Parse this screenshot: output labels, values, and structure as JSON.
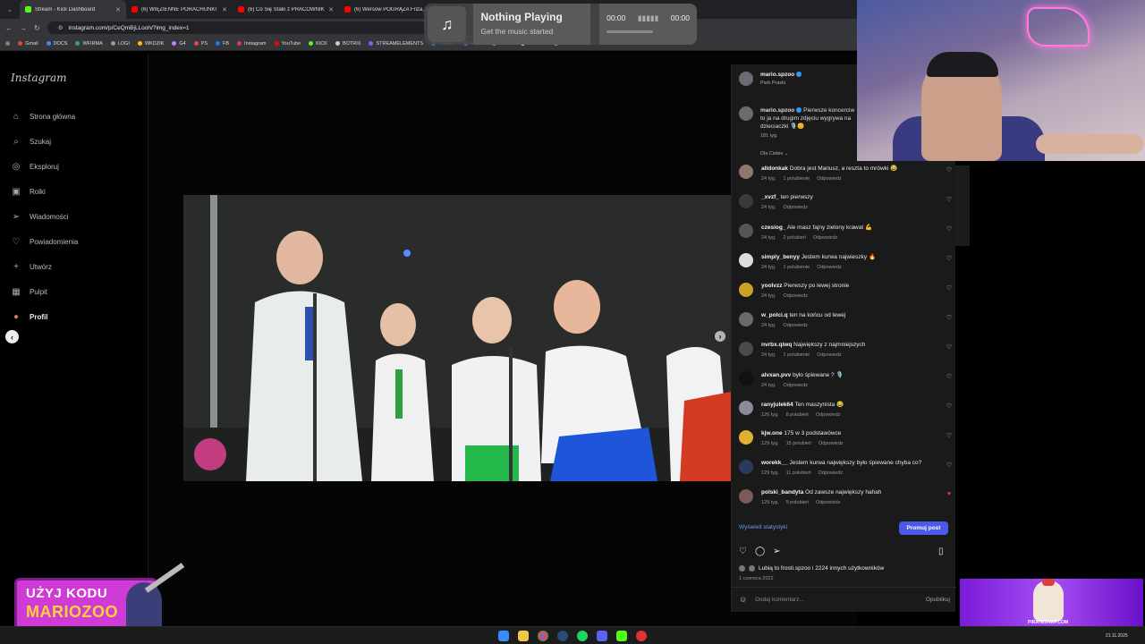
{
  "tabs": [
    {
      "label": "Stream - Kick Dashboard",
      "color": "#53fc18"
    },
    {
      "label": "(6) WIĘZIENNE PORACHUNKI |",
      "color": "#ff0000"
    },
    {
      "label": "(6) Co Się Stało z PRACOWNIK",
      "color": "#ff0000"
    },
    {
      "label": "(6) Wersow POGRĄŻA Friza, a",
      "color": "#ff0000"
    }
  ],
  "url": "instagram.com/p/CeQmBjLLooh/?img_index=1",
  "bookmarks": [
    "Gmail",
    "DOCS",
    "WFIRMA",
    "LOGI",
    "WKDZIK",
    "G4",
    "PS",
    "FB",
    "Instagram",
    "YouTube",
    "KICK",
    "BOTRIX",
    "STREAMELEMENTS",
    "TWEET",
    "HYPE",
    "NEST",
    "TIKTOK",
    "NATIVNOSE"
  ],
  "now_playing": {
    "title": "Nothing Playing",
    "subtitle": "Get the music started",
    "time_start": "00:00",
    "time_end": "00:00"
  },
  "sidebar": {
    "logo": "Instagram",
    "items": [
      {
        "label": "Strona główna",
        "icon": "home-icon",
        "glyph": "⌂"
      },
      {
        "label": "Szukaj",
        "icon": "search-icon",
        "glyph": "⌕"
      },
      {
        "label": "Eksploruj",
        "icon": "compass-icon",
        "glyph": "◎"
      },
      {
        "label": "Rolki",
        "icon": "reels-icon",
        "glyph": "▣"
      },
      {
        "label": "Wiadomości",
        "icon": "send-icon",
        "glyph": "➢"
      },
      {
        "label": "Powiadomienia",
        "icon": "heart-icon",
        "glyph": "♡"
      },
      {
        "label": "Utwórz",
        "icon": "plus-icon",
        "glyph": "+"
      },
      {
        "label": "Pulpit",
        "icon": "dashboard-icon",
        "glyph": "▦"
      },
      {
        "label": "Profil",
        "icon": "avatar-icon",
        "glyph": "●"
      }
    ]
  },
  "post": {
    "username": "mario.spzoo",
    "location": "Park Praski",
    "caption": "Pierwsze koncerciw to ja na drugim zdjęciu wygrywa na dzieciaczki 🎙️😊",
    "caption_time": "181 tyg.",
    "filter_label": "Dla Ciebie",
    "comments": [
      {
        "user": "alldonkak",
        "text": "Dobra jest Mariusz, a reszta to mrówki 😂",
        "time": "24 tyg.",
        "likes": "1 polubienie",
        "reply": "Odpowiedz",
        "avatar": "#8a7a70",
        "liked": false
      },
      {
        "user": "_xvzf_",
        "text": "ten pierwszy",
        "time": "24 tyg.",
        "likes": "",
        "reply": "Odpowiedz",
        "avatar": "#3a3a3a",
        "liked": false
      },
      {
        "user": "czesiog_",
        "text": "Ale masz fajny zielony krawat 💪",
        "time": "24 tyg.",
        "likes": "2 polubień",
        "reply": "Odpowiedz",
        "avatar": "#555555",
        "liked": false
      },
      {
        "user": "simply_benyy",
        "text": "Jestem kurwa najwieszky 🔥",
        "time": "24 tyg.",
        "likes": "1 polubienie",
        "reply": "Odpowiedz",
        "avatar": "#dddddd",
        "liked": false
      },
      {
        "user": "yoolvzz",
        "text": "Pierwszy po lewej stronie",
        "time": "24 tyg.",
        "likes": "",
        "reply": "Odpowiedz",
        "avatar": "#c9a227",
        "liked": false
      },
      {
        "user": "w_polci.q",
        "text": "ten na końcu od lewej",
        "time": "24 tyg.",
        "likes": "",
        "reply": "Odpowiedz",
        "avatar": "#6a6a6a",
        "liked": false
      },
      {
        "user": "nvrbx.qiwq",
        "text": "Największy z najmniejszych",
        "time": "24 tyg.",
        "likes": "1 polubienie",
        "reply": "Odpowiedz",
        "avatar": "#4a4a4a",
        "liked": false
      },
      {
        "user": "alvxan.pvv",
        "text": "było śpiewane ? 🎙️",
        "time": "24 tyg.",
        "likes": "",
        "reply": "Odpowiedz",
        "avatar": "#111111",
        "liked": false
      },
      {
        "user": "ranyjulek64",
        "text": "Ten maszynista 😂",
        "time": "126 tyg.",
        "likes": "8 polubień",
        "reply": "Odpowiedz",
        "avatar": "#8a8a9a",
        "liked": false
      },
      {
        "user": "kjw.one",
        "text": "175 w 3 podstawówce",
        "time": "129 tyg.",
        "likes": "15 polubień",
        "reply": "Odpowiedz",
        "avatar": "#e0b030",
        "liked": false
      },
      {
        "user": "worekk__",
        "text": "Jestem kurwa największy było śpiewane chyba co?",
        "time": "129 tyg.",
        "likes": "11 polubień",
        "reply": "Odpowiedz",
        "avatar": "#2a3a5a",
        "liked": false
      },
      {
        "user": "polski_bandyta",
        "text": "Od zawsze największy hahah",
        "time": "129 tyg.",
        "likes": "9 polubień",
        "reply": "Odpowiedz",
        "avatar": "#7a5a5a",
        "liked": true
      }
    ],
    "stats_label": "Wyświetl statystyki",
    "promote_label": "Promuj post",
    "likes_text": "Lubią to frosti.spzoo i 2224 innych użytkowników",
    "date": "1 czerwca 2022",
    "comment_placeholder": "Dodaj komentarz...",
    "publish_label": "Opublikuj"
  },
  "promo_code": {
    "line1": "UŻYJ KODU",
    "line2": "MARIOZOO"
  },
  "ad_text": "PIRATESWAP.COM",
  "clock": "21.11.2025",
  "colors": {
    "accent": "#4b58e8",
    "link": "#6b9bf5",
    "promo_bg": "#d03ad6",
    "promo_text": "#ffd23a"
  }
}
